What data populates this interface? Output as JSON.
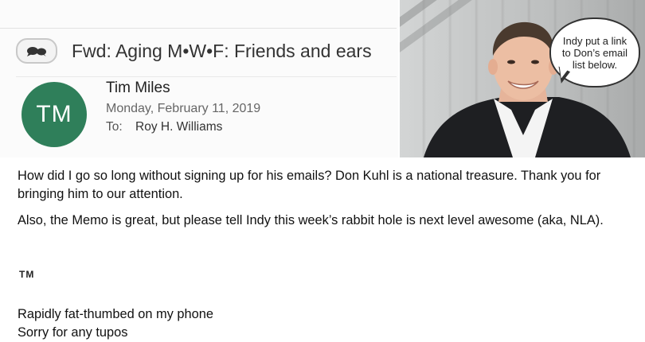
{
  "email": {
    "subject": "Fwd: Aging M•W•F: Friends and ears",
    "avatar_initials": "TM",
    "sender_name": "Tim Miles",
    "date": "Monday, February 11, 2019",
    "to_label": "To:",
    "to_value": "Roy H. Williams"
  },
  "photo": {
    "icon": "person-photo",
    "bubble_text": "Indy put a link to Don’s email list below."
  },
  "body": {
    "paragraph_1": "How did I go so long without signing up for his emails? Don Kuhl is a national treasure. Thank you for bringing him to our attention.",
    "paragraph_2": "Also, the Memo is great, but please tell Indy this week’s rabbit hole is next level awesome (aka, NLA).",
    "signature_initials": "TM",
    "footer_line_1": "Rapidly fat-thumbed on my phone",
    "footer_line_2": "Sorry for any tupos"
  },
  "colors": {
    "avatar_bg": "#2f7f5a",
    "header_bg": "#fbfbfb"
  }
}
